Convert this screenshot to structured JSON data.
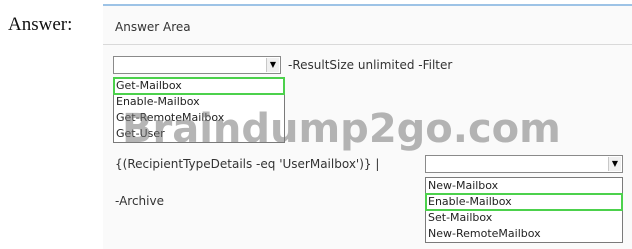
{
  "answer_label": "Answer:",
  "answer_area_title": "Answer Area",
  "line1_text": "-ResultSize unlimited -Filter",
  "dropdown1": {
    "selected": "",
    "options": [
      {
        "label": "Get-Mailbox",
        "correct": true
      },
      {
        "label": "Enable-Mailbox",
        "correct": false
      },
      {
        "label": "Get-RemoteMailbox",
        "correct": false
      },
      {
        "label": "Get-User",
        "correct": false
      }
    ]
  },
  "line2_text": "{(RecipientTypeDetails -eq 'UserMailbox')} |",
  "dropdown2": {
    "selected": "",
    "options": [
      {
        "label": "New-Mailbox",
        "correct": false
      },
      {
        "label": "Enable-Mailbox",
        "correct": true
      },
      {
        "label": "Set-Mailbox",
        "correct": false
      },
      {
        "label": "New-RemoteMailbox",
        "correct": false
      }
    ]
  },
  "line3_text": "-Archive",
  "watermark": "Braindump2go.com",
  "colors": {
    "highlight": "#4cd14c",
    "header_border": "#9dc3e6"
  }
}
